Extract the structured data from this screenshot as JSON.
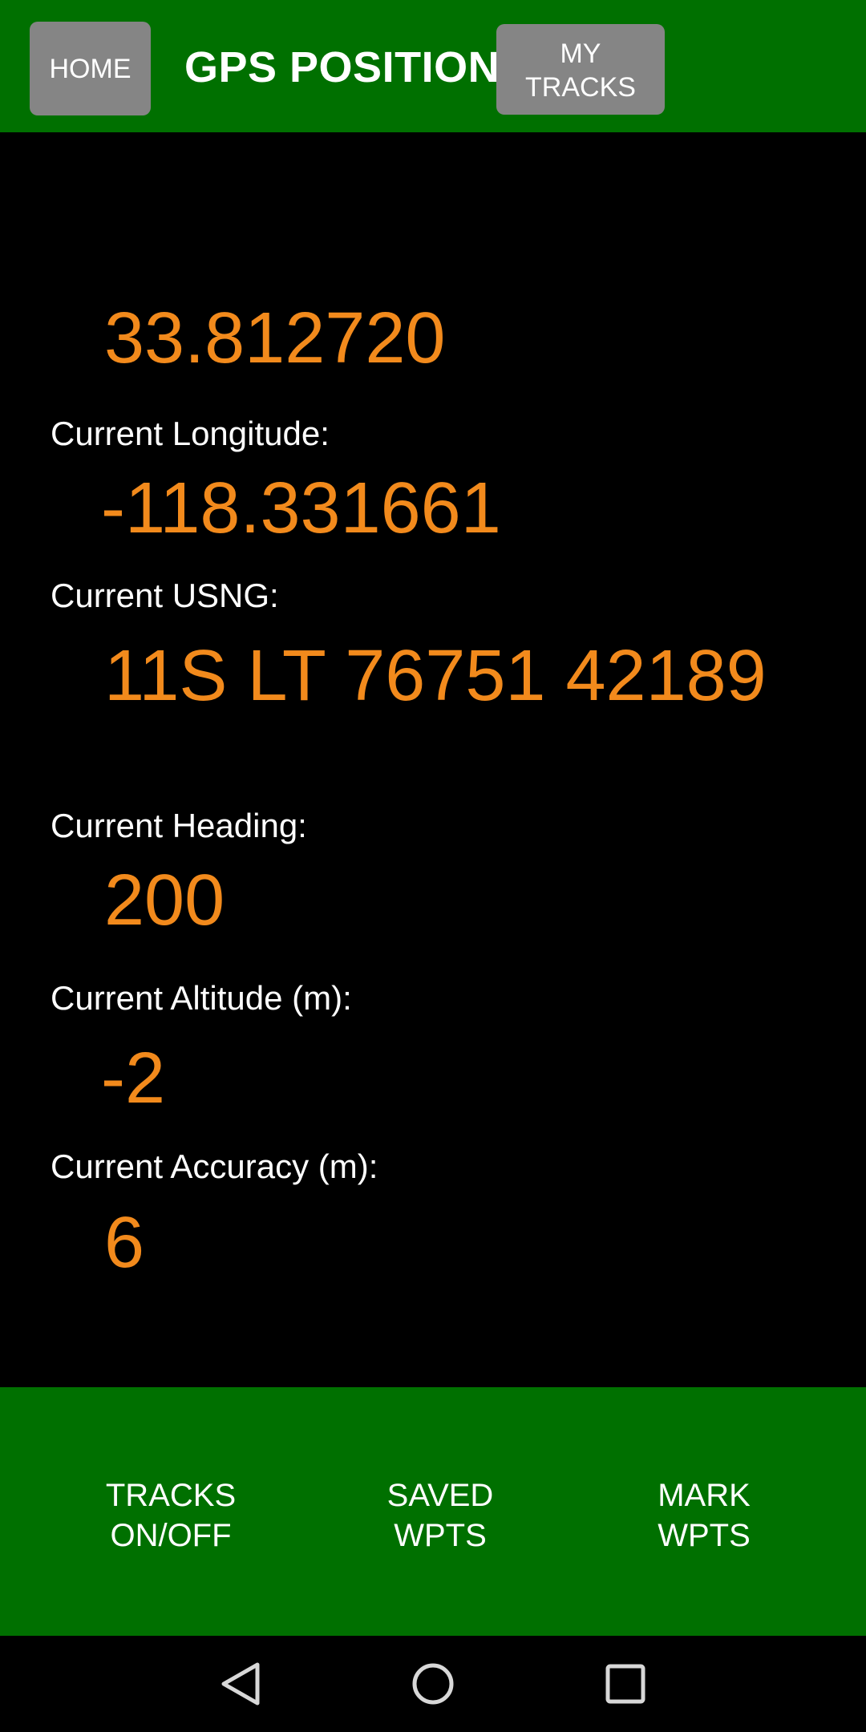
{
  "header": {
    "home_label": "HOME",
    "title": "GPS POSITION",
    "my_tracks_label": "MY\nTRACKS"
  },
  "position": {
    "latitude_value": "33.812720",
    "longitude_label": "Current Longitude:",
    "longitude_value": "-118.331661",
    "usng_label": "Current USNG:",
    "usng_value": "11S LT 76751 42189",
    "heading_label": "Current Heading:",
    "heading_value": "200",
    "altitude_label": "Current Altitude (m):",
    "altitude_value": "-2",
    "accuracy_label": "Current Accuracy (m):",
    "accuracy_value": "6"
  },
  "actions": {
    "tracks_toggle": "TRACKS\nON/OFF",
    "saved_waypoints": "SAVED\nWPTS",
    "mark_waypoints": "MARK\nWPTS"
  },
  "colors": {
    "bar_green": "#007000",
    "button_gray": "#858585",
    "value_orange": "#f28a1c",
    "background": "#000000"
  },
  "icons": {
    "back": "triangle-back-icon",
    "home": "circle-home-icon",
    "recents": "square-recents-icon"
  }
}
